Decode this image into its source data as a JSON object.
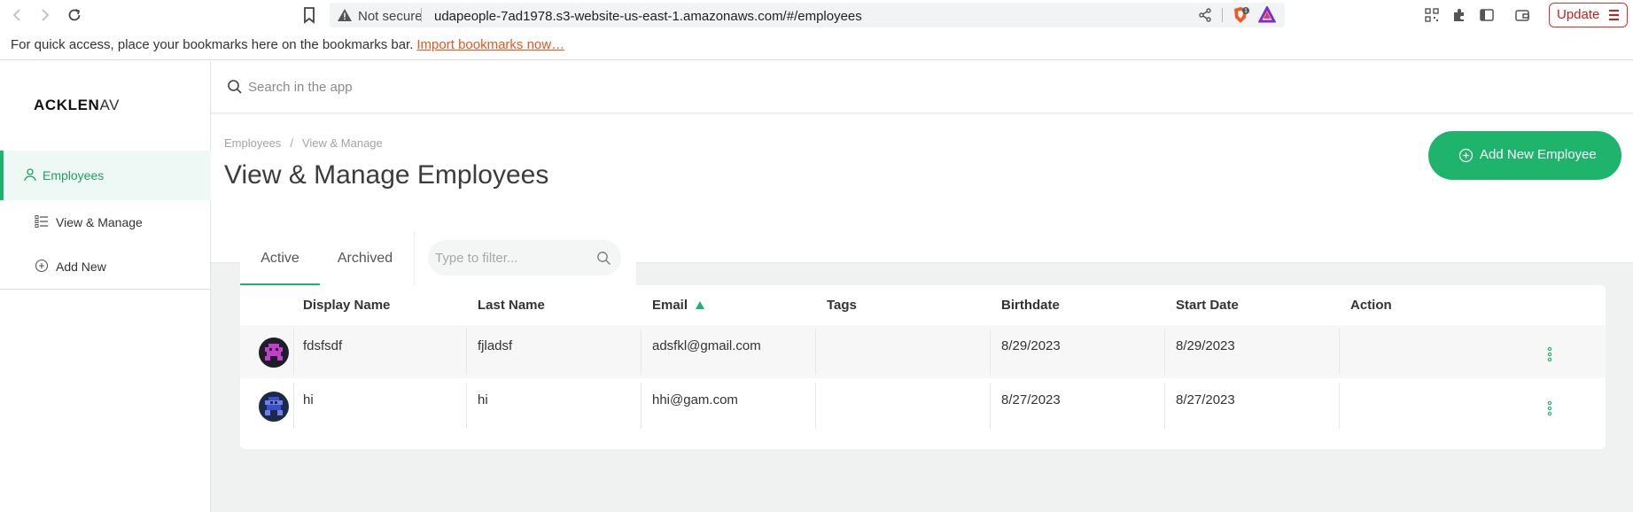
{
  "browser": {
    "not_secure_label": "Not secure",
    "url": "udapeople-7ad1978.s3-website-us-east-1.amazonaws.com/#/employees",
    "update_label": "Update",
    "bookmarks_message": "For quick access, place your bookmarks here on the bookmarks bar.",
    "import_bookmarks_label": "Import bookmarks now…"
  },
  "app": {
    "logo": {
      "bold": "ACKLEN",
      "thin": "AV"
    },
    "sidebar": {
      "items": [
        {
          "label": "Employees",
          "icon": "user-icon",
          "active": true
        },
        {
          "label": "View & Manage",
          "icon": "list-icon",
          "active": false
        },
        {
          "label": "Add New",
          "icon": "plus-circle-icon",
          "active": false
        }
      ]
    },
    "search": {
      "placeholder": "Search in the app"
    },
    "breadcrumb": [
      "Employees",
      "View & Manage"
    ],
    "page_title": "View & Manage Employees",
    "add_button_label": "Add New Employee",
    "tabs": [
      {
        "label": "Active",
        "active": true
      },
      {
        "label": "Archived",
        "active": false
      }
    ],
    "filter": {
      "placeholder": "Type to filter..."
    },
    "table": {
      "columns": [
        "Display Name",
        "Last Name",
        "Email",
        "Tags",
        "Birthdate",
        "Start Date",
        "Action"
      ],
      "sorted_column": "Email",
      "rows": [
        {
          "display_name": "fdsfsdf",
          "last_name": "fjladsf",
          "email": "adsfkl@gmail.com",
          "tags": "",
          "birthdate": "8/29/2023",
          "start_date": "8/29/2023",
          "avatar_color": "#c13fc9"
        },
        {
          "display_name": "hi",
          "last_name": "hi",
          "email": "hhi@gam.com",
          "tags": "",
          "birthdate": "8/27/2023",
          "start_date": "8/27/2023",
          "avatar_color": "#3a4fd0"
        }
      ]
    }
  },
  "colors": {
    "accent": "#1fb46b",
    "update_red": "#c5221f",
    "link_orange": "#e8551f"
  }
}
